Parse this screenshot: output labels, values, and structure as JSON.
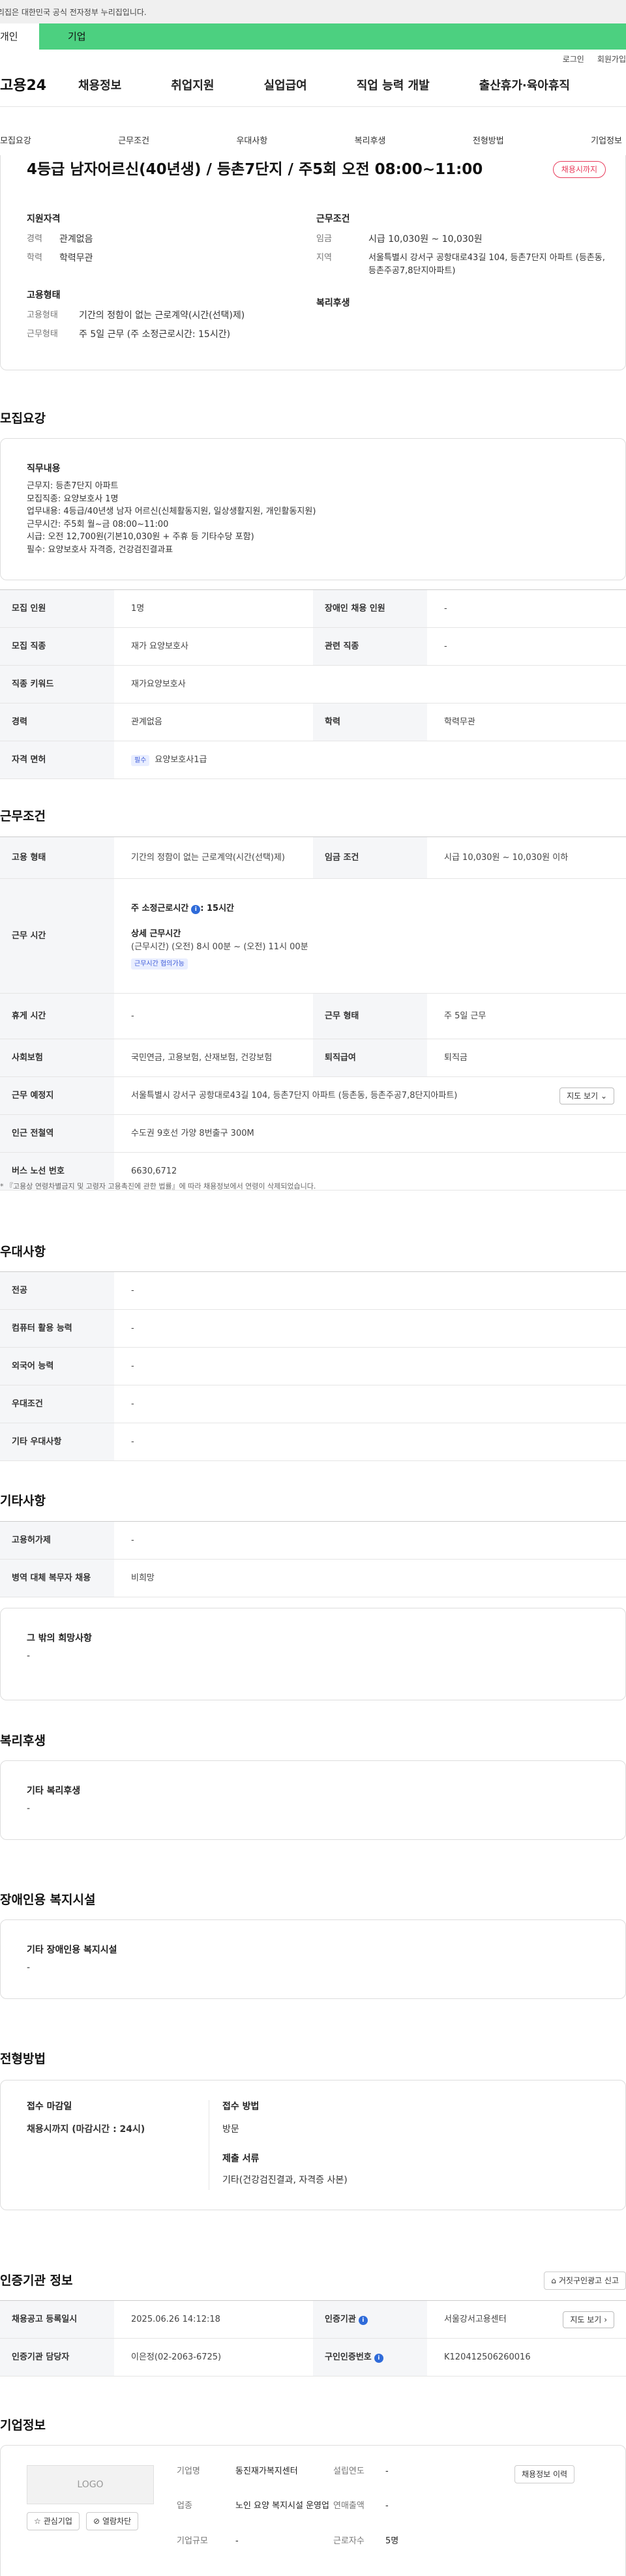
{
  "gov_bar": {
    "text": "이 누리집은 대한민국 공식 전자정부 누리집입니다."
  },
  "user_tabs": [
    {
      "label": "개인"
    },
    {
      "label": "기업"
    }
  ],
  "util": {
    "login": "로그인",
    "join": "회원가입"
  },
  "gnb": {
    "logo": "고용24",
    "menus": [
      "채용정보",
      "취업지원",
      "실업급여",
      "직업 능력 개발",
      "출산휴가·육아휴직"
    ]
  },
  "subnav": [
    "모집요강",
    "근무조건",
    "우대사항",
    "복리후생",
    "전형방법",
    "기업정보"
  ],
  "job": {
    "title": "4등급 남자어르신(40년생) / 등촌7단지 / 주5회 오전 08:00~11:00",
    "status": "채용시까지",
    "qual_heading": "지원자격",
    "career_k": "경력",
    "career_v": "관계없음",
    "edu_k": "학력",
    "edu_v": "학력무관",
    "emp_heading": "고용형태",
    "emptype_k": "고용형태",
    "emptype_v": "기간의 정함이 없는 근로계약(시간(선택)제)",
    "worktime_k": "근무형태",
    "worktime_v": "주 5일 근무 (주 소정근로시간: 15시간)",
    "cond_heading": "근무조건",
    "wage_k": "임금",
    "wage_v": "시급 10,030원 ~ 10,030원",
    "region_k": "지역",
    "region_v": "서울특별시 강서구 공항대로43길 104, 등촌7단지 아파트 (등촌동, 등촌주공7,8단지아파트)",
    "welfare_heading": "복리후생"
  },
  "recruit": {
    "heading": "모집요강",
    "duty_heading": "직무내용",
    "duty_lines": [
      "근무지: 등촌7단지 아파트",
      "모집직종: 요양보호사 1명",
      "업무내용: 4등급/40년생 남자 어르신(신체활동지원, 일상생활지원, 개인활동지원)",
      "근무시간: 주5회 월~금 08:00~11:00",
      "시급: 오전 12,700원(기본10,030원 + 주휴 등 기타수당 포함)",
      "필수: 요양보호사 자격증, 건강검진결과표"
    ],
    "rows": {
      "count_h": "모집 인원",
      "count_v": "1명",
      "disabled_h": "장애인 채용 인원",
      "disabled_v": "-",
      "job_h": "모집 직종",
      "job_v": "재가 요양보호사",
      "related_h": "관련 직종",
      "related_v": "-",
      "kw_h": "직종 키워드",
      "kw_v": "재가요양보호사",
      "career_h": "경력",
      "career_v": "관계없음",
      "edu_h": "학력",
      "edu_v": "학력무관",
      "lic_h": "자격 면허",
      "lic_chip": "필수",
      "lic_v": "요양보호사1급"
    }
  },
  "work": {
    "heading": "근무조건",
    "emptype_h": "고용 형태",
    "emptype_v": "기간의 정함이 없는 근로계약(시간(선택)제)",
    "wage_h": "임금 조건",
    "wage_v": "시급 10,030원 ~ 10,030원 이하",
    "time_h": "근무 시간",
    "time_weekly": "주 소정근로시간",
    "time_weekly_v": ": 15시간",
    "time_detail_title": "상세 근무시간",
    "time_detail_v": "(근무시간) (오전) 8시 00분 ~ (오전) 11시 00분",
    "time_chip": "근무시간 협의가능",
    "rest_h": "휴게 시간",
    "rest_v": "-",
    "form_h": "근무 형태",
    "form_v": "주 5일 근무",
    "ins_h": "사회보험",
    "ins_v": "국민연금, 고용보험, 산재보험, 건강보험",
    "retire_h": "퇴직급여",
    "retire_v": "퇴직금",
    "place_h": "근무 예정지",
    "place_v": "서울특별시 강서구 공항대로43길 104, 등촌7단지 아파트 (등촌동, 등촌주공7,8단지아파트)",
    "map_btn": "지도 보기",
    "subway_h": "인근 전철역",
    "subway_v": "수도권 9호선 가양 8번출구 300M",
    "bus_h": "버스 노선 번호",
    "bus_v": "6630,6712",
    "note": "* 『고용상 연령차별금지 및 고령자 고용촉진에 관한 법률』에 따라 채용정보에서 연령이 삭제되었습니다."
  },
  "pref": {
    "heading": "우대사항",
    "rows": [
      {
        "h": "전공",
        "v": "-"
      },
      {
        "h": "컴퓨터 활용 능력",
        "v": "-"
      },
      {
        "h": "외국어 능력",
        "v": "-"
      },
      {
        "h": "우대조건",
        "v": "-"
      },
      {
        "h": "기타 우대사항",
        "v": "-"
      }
    ]
  },
  "etc": {
    "heading": "기타사항",
    "rows": [
      {
        "h": "고용허가제",
        "v": "-"
      },
      {
        "h": "병역 대체 복무자 채용",
        "v": "비희망"
      }
    ],
    "other_title": "그 밖의 희망사항",
    "other_v": "-"
  },
  "welfare": {
    "heading": "복리후생",
    "box_title": "기타 복리후생",
    "box_v": "-"
  },
  "facility": {
    "heading": "장애인용 복지시설",
    "box_title": "기타 장애인용 복지시설",
    "box_v": "-"
  },
  "process": {
    "heading": "전형방법",
    "deadline_t": "접수 마감일",
    "deadline_v": "채용시까지 (마감시간 : 24시)",
    "method_t": "접수 방법",
    "method_v": "방문",
    "docs_t": "제출 서류",
    "docs_v": "기타(건강검진결과, 자격증 사본)"
  },
  "agency": {
    "heading": "인증기관 정보",
    "report_btn": "거짓구인광고 신고",
    "reg_h": "채용공고 등록일시",
    "reg_v": "2025.06.26 14:12:18",
    "org_h": "인증기관",
    "org_v": "서울강서고용센터",
    "dir_btn": "지도 보기",
    "mgr_h": "인증기관 담당자",
    "mgr_v": "이은정(02-2063-6725)",
    "no_h": "구인인증번호",
    "no_v": "K120412506260016"
  },
  "company": {
    "heading": "기업정보",
    "logo": "LOGO",
    "fav_btn": "관심기업",
    "block_btn": "열람차단",
    "name_k": "기업명",
    "name_v": "동진재가복지센터",
    "found_k": "설립연도",
    "found_v": "-",
    "biz_k": "업종",
    "biz_v": "노인 요양 복지시설 운영업",
    "sales_k": "연매출액",
    "sales_v": "-",
    "size_k": "기업규모",
    "size_v": "-",
    "emp_k": "근로자수",
    "emp_v": "5명",
    "history_btn": "채용정보 이력"
  },
  "colors": {
    "accent_green": "#4cd080",
    "status_red": "#e5284a",
    "info_blue": "#2f6bd9"
  }
}
